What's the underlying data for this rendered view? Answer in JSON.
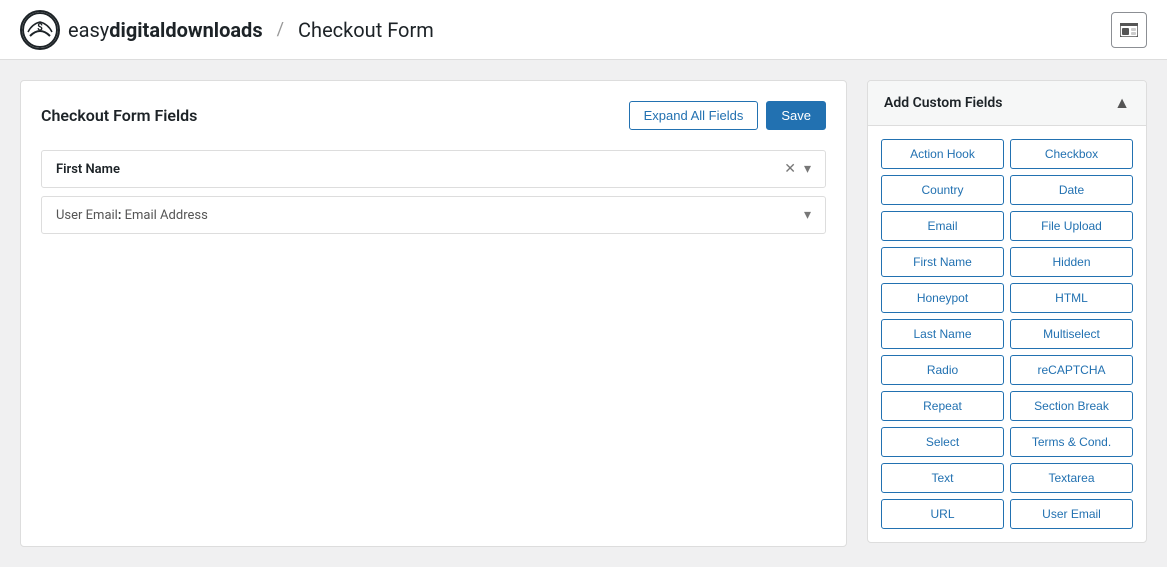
{
  "header": {
    "brand": "easydigitaldownloads",
    "brand_easy": "easy",
    "brand_digital": "digital",
    "brand_downloads": "downloads",
    "breadcrumb_sep": "/",
    "page_title": "Checkout Form",
    "preview_icon": "⬛"
  },
  "left_panel": {
    "title": "Checkout Form Fields",
    "expand_all_label": "Expand All Fields",
    "save_label": "Save",
    "fields": [
      {
        "label": "First Name",
        "type": "simple"
      },
      {
        "label": "User Email",
        "sub_label": "Email Address",
        "type": "sub"
      }
    ]
  },
  "right_panel": {
    "title": "Add Custom Fields",
    "collapse_icon": "▲",
    "buttons": [
      "Action Hook",
      "Checkbox",
      "Country",
      "Date",
      "Email",
      "File Upload",
      "First Name",
      "Hidden",
      "Honeypot",
      "HTML",
      "Last Name",
      "Multiselect",
      "Radio",
      "reCAPTCHA",
      "Repeat",
      "Section Break",
      "Select",
      "Terms & Cond.",
      "Text",
      "Textarea",
      "URL",
      "User Email"
    ]
  }
}
